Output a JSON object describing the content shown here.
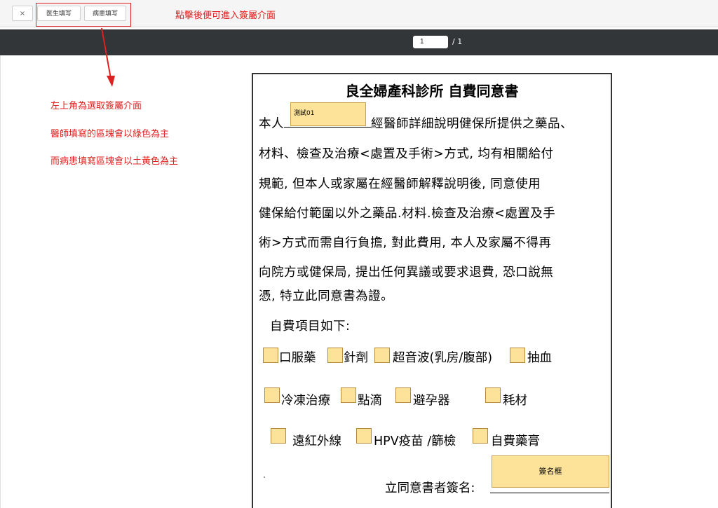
{
  "toolbar": {
    "close_label": "×",
    "doctor_button": "医生填写",
    "patient_button": "病患填写",
    "annotation": "點擊後便可進入簽屬介面"
  },
  "pager": {
    "current_page": "1",
    "total": "/ 1"
  },
  "side_notes": [
    "左上角為選取簽屬介面",
    "醫師填寫的區塊會以綠色為主",
    "而病患填寫區塊會以土黃色為主"
  ],
  "document": {
    "title": "良全婦產科診所 自費同意書",
    "line1_prefix": "本人",
    "line1_suffix": "經醫師詳細說明健保所提供之藥品、",
    "lines": [
      "材料、檢查及治療<處置及手術>方式, 均有相關給付",
      "規範, 但本人或家屬在經醫師解釋說明後, 同意使用",
      "健保給付範圍以外之藥品.材料.檢查及治療<處置及手",
      "術>方式而需自行負擔, 對此費用, 本人及家屬不得再",
      "向院方或健保局, 提出任何異議或要求退費, 恐口說無",
      "憑, 特立此同意書為證。"
    ],
    "items_heading": "自費項目如下:",
    "test_field_value": "測試01",
    "items": [
      "口服藥",
      "針劑",
      "超音波(乳房/腹部)",
      "抽血",
      "冷凍治療",
      "點滴",
      "避孕器",
      "耗材",
      "遠紅外線",
      "HPV疫苗 /篩檢",
      "自費藥膏"
    ],
    "signature_label": "立同意書者簽名:",
    "signature_box": "簽名框"
  },
  "colors": {
    "patient_field": "#fde39a",
    "annotation_red": "#e02020",
    "pager_bg": "#323639"
  }
}
